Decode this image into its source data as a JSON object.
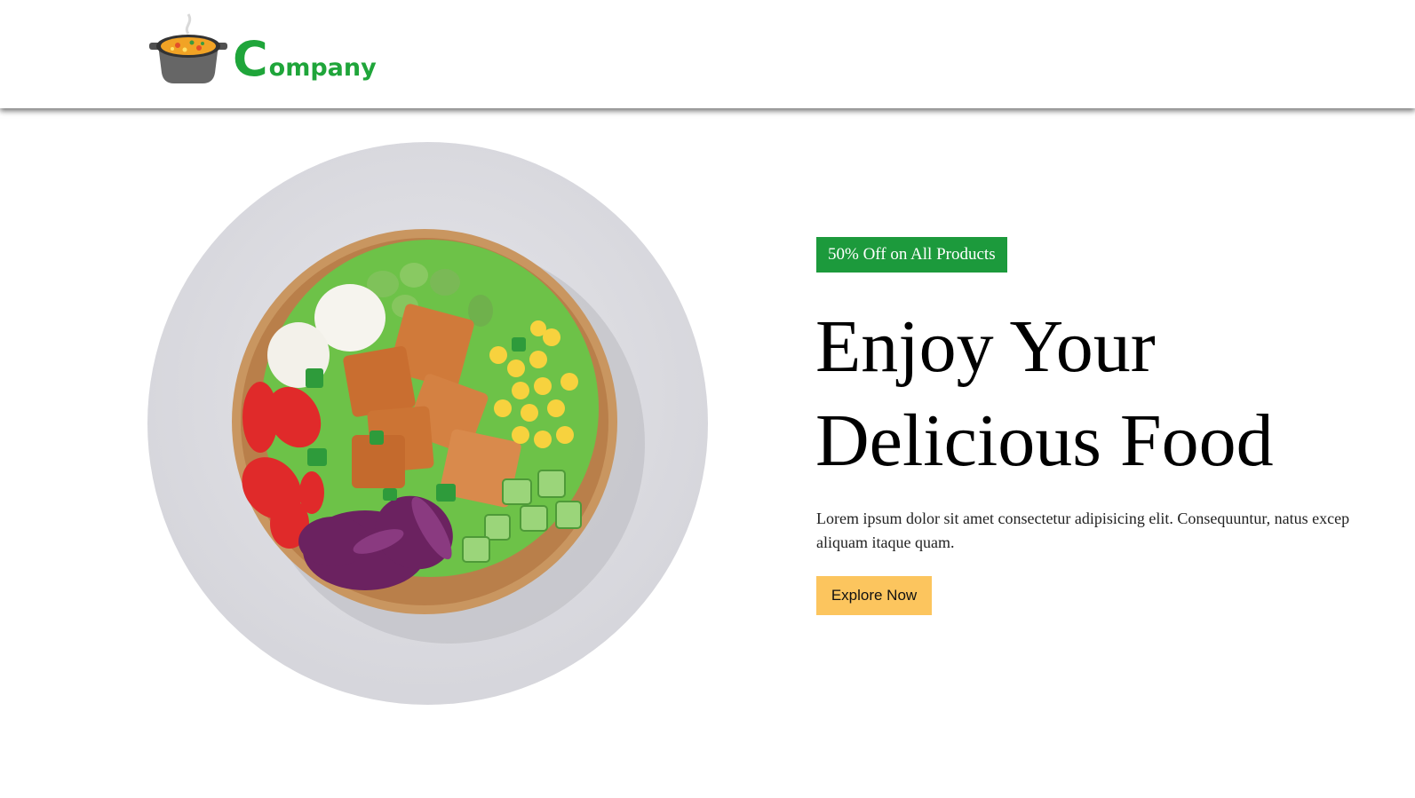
{
  "header": {
    "logo": {
      "icon": "cooking-pot-icon",
      "first_letter": "C",
      "rest": "ompany",
      "color": "#1fa53a"
    }
  },
  "hero": {
    "image": "salad-bowl-image",
    "promo_label": "50% Off on All Products",
    "promo_color": "#1c9a3c",
    "headline_line1": "Enjoy Your",
    "headline_line2": "Delicious Food",
    "description_line1": "Lorem ipsum dolor sit amet consectetur adipisicing elit. Consequuntur, natus excep",
    "description_line2": "aliquam itaque quam.",
    "cta_label": "Explore Now",
    "cta_color": "#fcc55e"
  }
}
